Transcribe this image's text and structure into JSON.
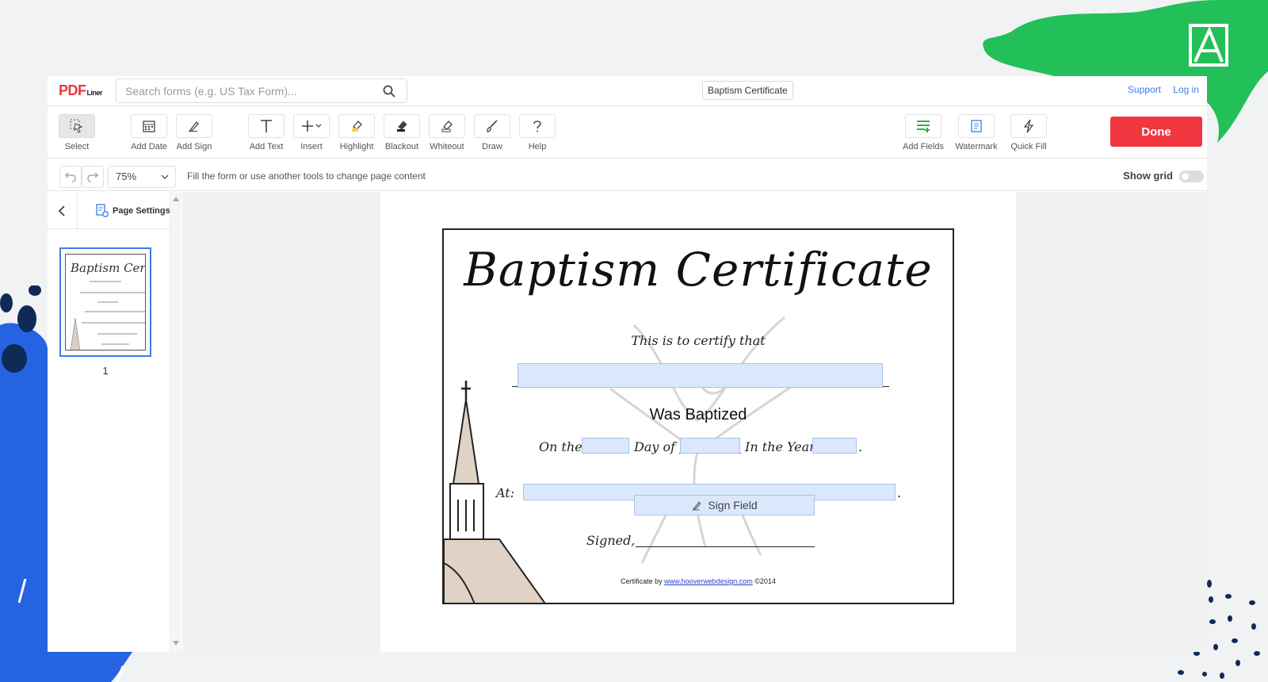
{
  "header": {
    "logo_main": "PDF",
    "logo_sub": "Liner",
    "search_placeholder": "Search forms (e.g. US Tax Form)...",
    "document_title": "Baptism Certificate",
    "support_link": "Support",
    "login_link": "Log in"
  },
  "toolbar": {
    "tools": [
      {
        "label": "Select",
        "icon": "cursor-select-icon"
      },
      {
        "label": "Add Date",
        "icon": "calendar-icon"
      },
      {
        "label": "Add Sign",
        "icon": "pen-sign-icon"
      },
      {
        "label": "Add Text",
        "icon": "text-icon"
      },
      {
        "label": "Insert",
        "icon": "plus-icon"
      },
      {
        "label": "Highlight",
        "icon": "highlighter-icon"
      },
      {
        "label": "Blackout",
        "icon": "blackout-icon"
      },
      {
        "label": "Whiteout",
        "icon": "eraser-icon"
      },
      {
        "label": "Draw",
        "icon": "brush-icon"
      },
      {
        "label": "Help",
        "icon": "question-icon"
      }
    ],
    "right_tools": [
      {
        "label": "Add Fields",
        "icon": "fields-icon"
      },
      {
        "label": "Watermark",
        "icon": "watermark-icon"
      },
      {
        "label": "Quick Fill",
        "icon": "lightning-icon"
      }
    ],
    "done_label": "Done",
    "accent_color": "#f0363f",
    "link_color": "#3d7de4",
    "fields_color": "#2bb24c"
  },
  "subbar": {
    "zoom": "75%",
    "hint": "Fill the form or use another tools to change page content",
    "show_grid_label": "Show grid",
    "show_grid_on": false
  },
  "sidebar": {
    "page_settings_label": "Page Settings",
    "pages": [
      {
        "number": "1"
      }
    ]
  },
  "certificate": {
    "title": "Baptism Certificate",
    "certify_text": "This is to certify that",
    "baptized_text": "Was Baptized",
    "on_the": "On the",
    "day_of": "Day of",
    "in_the_year": "In the Year",
    "at_label": "At:",
    "sign_field_label": "Sign Field",
    "signed_label": "Signed,",
    "credit_prefix": "Certificate  by",
    "credit_link": "www.hooverwebdesign.com",
    "credit_suffix": "©2014"
  }
}
